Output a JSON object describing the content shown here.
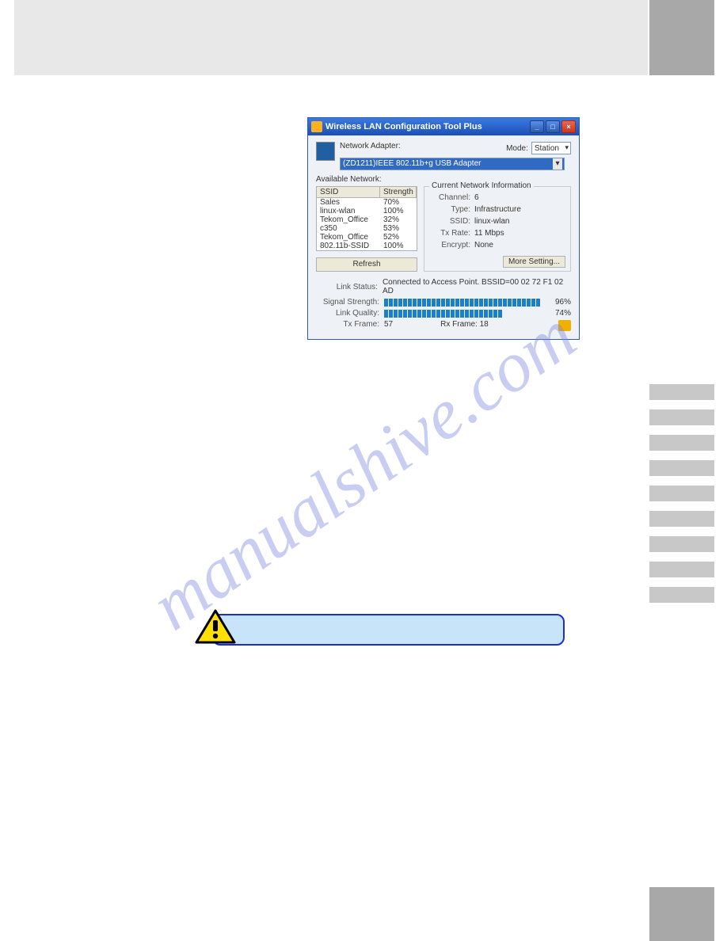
{
  "watermark": "manualshive.com",
  "dialog": {
    "title": "Wireless LAN Configuration Tool Plus",
    "adapter_label": "Network Adapter:",
    "mode_label": "Mode:",
    "mode_value": "Station",
    "adapter_value": "(ZD1211)IEEE 802.11b+g USB Adapter",
    "available_label": "Available Network:",
    "columns": {
      "ssid": "SSID",
      "strength": "Strength"
    },
    "networks": [
      {
        "ssid": "Sales",
        "strength": "70%"
      },
      {
        "ssid": "linux-wlan",
        "strength": "100%"
      },
      {
        "ssid": "Tekom_Office",
        "strength": "32%"
      },
      {
        "ssid": "c350",
        "strength": "53%"
      },
      {
        "ssid": "Tekom_Office",
        "strength": "52%"
      },
      {
        "ssid": "802.11b-SSID",
        "strength": "100%"
      }
    ],
    "refresh_label": "Refresh",
    "info": {
      "title": "Current Network Information",
      "channel_label": "Channel:",
      "channel_value": "6",
      "type_label": "Type:",
      "type_value": "Infrastructure",
      "ssid_label": "SSID:",
      "ssid_value": "linux-wlan",
      "txrate_label": "Tx Rate:",
      "txrate_value": "11 Mbps",
      "encrypt_label": "Encrypt:",
      "encrypt_value": "None",
      "more_label": "More Setting..."
    },
    "status": {
      "link_status_label": "Link Status:",
      "link_status_value": "Connected to Access Point. BSSID=00 02 72 F1 02 AD",
      "signal_label": "Signal Strength:",
      "signal_pct": "96%",
      "quality_label": "Link Quality:",
      "quality_pct": "74%",
      "tx_frame_label": "Tx Frame:",
      "tx_frame_value": "57",
      "rx_frame_label": "Rx Frame:",
      "rx_frame_value": "18"
    }
  }
}
